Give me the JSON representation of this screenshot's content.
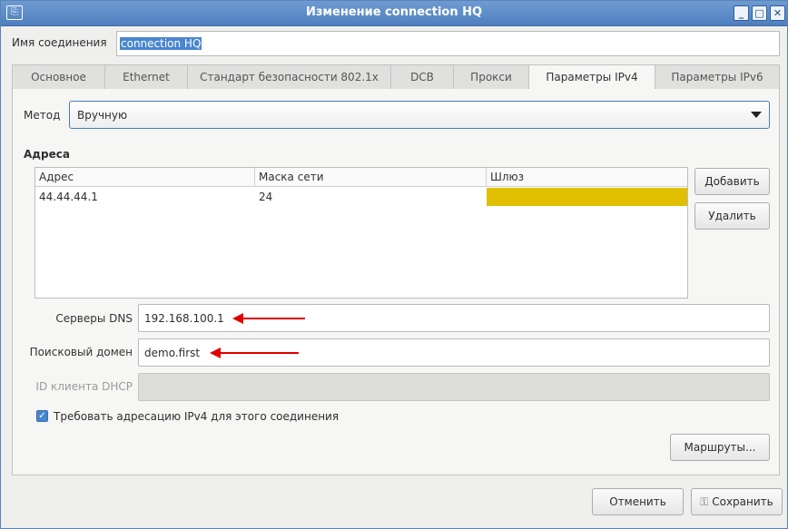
{
  "window": {
    "title": "Изменение connection HQ",
    "icons": [
      "app-icon",
      "minimize-icon",
      "maximize-icon",
      "close-icon"
    ]
  },
  "connection": {
    "name_label": "Имя соединения",
    "name_value": "connection HQ"
  },
  "tabs": [
    {
      "label": "Основное"
    },
    {
      "label": "Ethernet"
    },
    {
      "label": "Стандарт безопасности 802.1x"
    },
    {
      "label": "DCB"
    },
    {
      "label": "Прокси"
    },
    {
      "label": "Параметры IPv4",
      "active": true
    },
    {
      "label": "Параметры IPv6"
    }
  ],
  "method": {
    "label": "Метод",
    "value": "Вручную"
  },
  "addresses": {
    "title": "Адреса",
    "columns": [
      "Адрес",
      "Маска сети",
      "Шлюз"
    ],
    "rows": [
      {
        "address": "44.44.44.1",
        "netmask": "24",
        "gateway": ""
      }
    ],
    "gateway_highlight_color": "#e0c000",
    "add_label": "Добавить",
    "remove_label": "Удалить"
  },
  "dns": {
    "label": "Серверы DNS",
    "value": "192.168.100.1"
  },
  "search_domain": {
    "label": "Поисковый домен",
    "value": "demo.first"
  },
  "dhcp_client_id": {
    "label": "ID клиента DHCP",
    "value": ""
  },
  "require_ipv4": {
    "label": "Требовать адресацию IPv4 для этого соединения",
    "checked": true
  },
  "routes_label": "Маршруты...",
  "cancel_label": "Отменить",
  "save_label": "Сохранить",
  "annotation_color": "#e00000"
}
